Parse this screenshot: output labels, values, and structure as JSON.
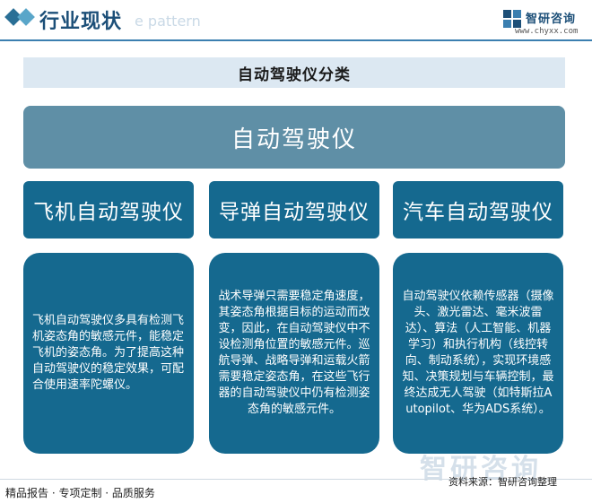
{
  "header": {
    "title": "行业现状",
    "watermark": "e pattern"
  },
  "brand": {
    "name": "智研咨询",
    "url": "www.chyxx.com"
  },
  "diagram": {
    "title": "自动驾驶仪分类",
    "root": "自动驾驶仪",
    "categories": [
      {
        "label": "飞机自动驾驶仪",
        "description": "飞机自动驾驶仪多具有检测飞机姿态角的敏感元件，能稳定飞机的姿态角。为了提高这种自动驾驶仪的稳定效果，可配合使用速率陀螺仪。"
      },
      {
        "label": "导弹自动驾驶仪",
        "description": "战术导弹只需要稳定角速度，其姿态角根据目标的运动而改变，因此，在自动驾驶仪中不设检测角位置的敏感元件。巡航导弹、战略导弹和运载火箭需要稳定姿态角，在这些飞行器的自动驾驶仪中仍有检测姿态角的敏感元件。"
      },
      {
        "label": "汽车自动驾驶仪",
        "description": "自动驾驶仪依赖传感器（摄像头、激光雷达、毫米波雷达）、算法（人工智能、机器学习）和执行机构（线控转向、制动系统），实现环境感知、决策规划与车辆控制，最终达成无人驾驶（如特斯拉Autopilot、华为ADS系统）。"
      }
    ]
  },
  "footer": {
    "left": "精品报告 · 专项定制 · 品质服务",
    "source": "资料来源：智研咨询整理"
  },
  "watermark": "智研咨询",
  "colors": {
    "primary": "#15698f",
    "root": "#5f8fa6",
    "title_bg": "#dce8f2",
    "header_text": "#1c4f78"
  }
}
